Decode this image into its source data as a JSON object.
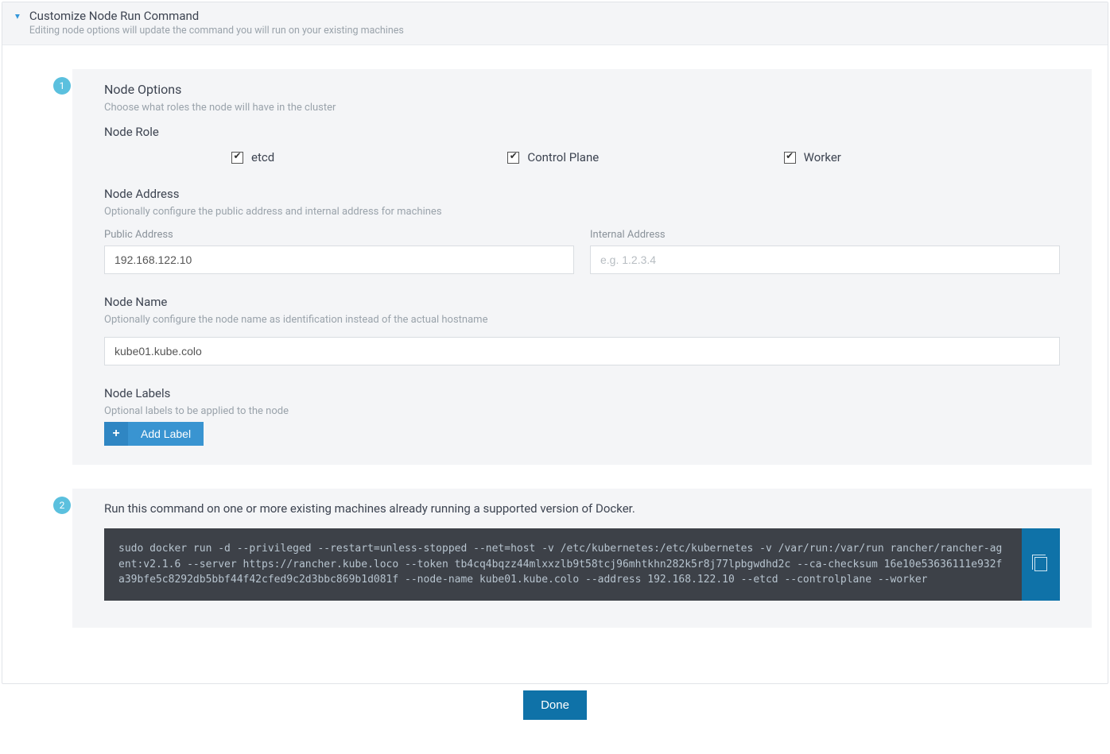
{
  "header": {
    "title": "Customize Node Run Command",
    "subtitle": "Editing node options will update the command you will run on your existing machines"
  },
  "step1": {
    "badge": "1",
    "title": "Node Options",
    "subtitle": "Choose what roles the node will have in the cluster",
    "role_label": "Node Role",
    "roles": {
      "etcd": "etcd",
      "cp": "Control Plane",
      "worker": "Worker"
    },
    "address": {
      "title": "Node Address",
      "subtitle": "Optionally configure the public address and internal address for machines",
      "public_label": "Public Address",
      "public_value": "192.168.122.10",
      "internal_label": "Internal Address",
      "internal_placeholder": "e.g. 1.2.3.4"
    },
    "name": {
      "title": "Node Name",
      "subtitle": "Optionally configure the node name as identification instead of the actual hostname",
      "value": "kube01.kube.colo"
    },
    "labels": {
      "title": "Node Labels",
      "subtitle": "Optional labels to be applied to the node",
      "add_label": "Add Label"
    }
  },
  "step2": {
    "badge": "2",
    "instruction": "Run this command on one or more existing machines already running a supported version of Docker.",
    "command": "sudo docker run -d --privileged --restart=unless-stopped --net=host -v /etc/kubernetes:/etc/kubernetes -v /var/run:/var/run rancher/rancher-agent:v2.1.6 --server https://rancher.kube.loco --token tb4cq4bqzz44mlxxzlb9t58tcj96mhtkhn282k5r8j77lpbgwdhd2c --ca-checksum 16e10e53636111e932fa39bfe5c8292db5bbf44f42cfed9c2d3bbc869b1d081f --node-name kube01.kube.colo --address 192.168.122.10 --etcd --controlplane --worker"
  },
  "footer": {
    "done": "Done"
  }
}
